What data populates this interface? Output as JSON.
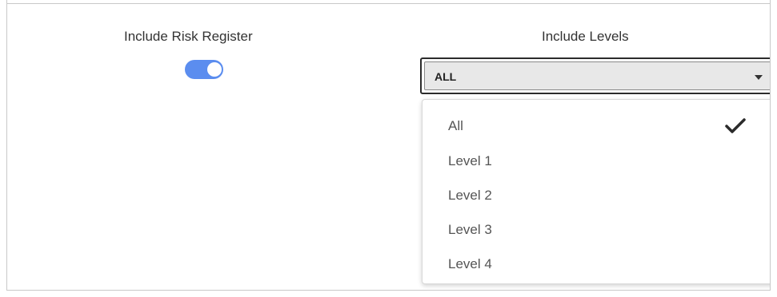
{
  "risk_register": {
    "label": "Include Risk Register",
    "enabled": true,
    "toggle_color": "#5b8def"
  },
  "levels": {
    "label": "Include Levels",
    "selected": "ALL",
    "options": [
      {
        "label": "All",
        "checked": true
      },
      {
        "label": "Level 1",
        "checked": false
      },
      {
        "label": "Level 2",
        "checked": false
      },
      {
        "label": "Level 3",
        "checked": false
      },
      {
        "label": "Level 4",
        "checked": false
      }
    ]
  },
  "icons": {
    "caret": "chevron-down-icon",
    "check": "checkmark-icon"
  }
}
